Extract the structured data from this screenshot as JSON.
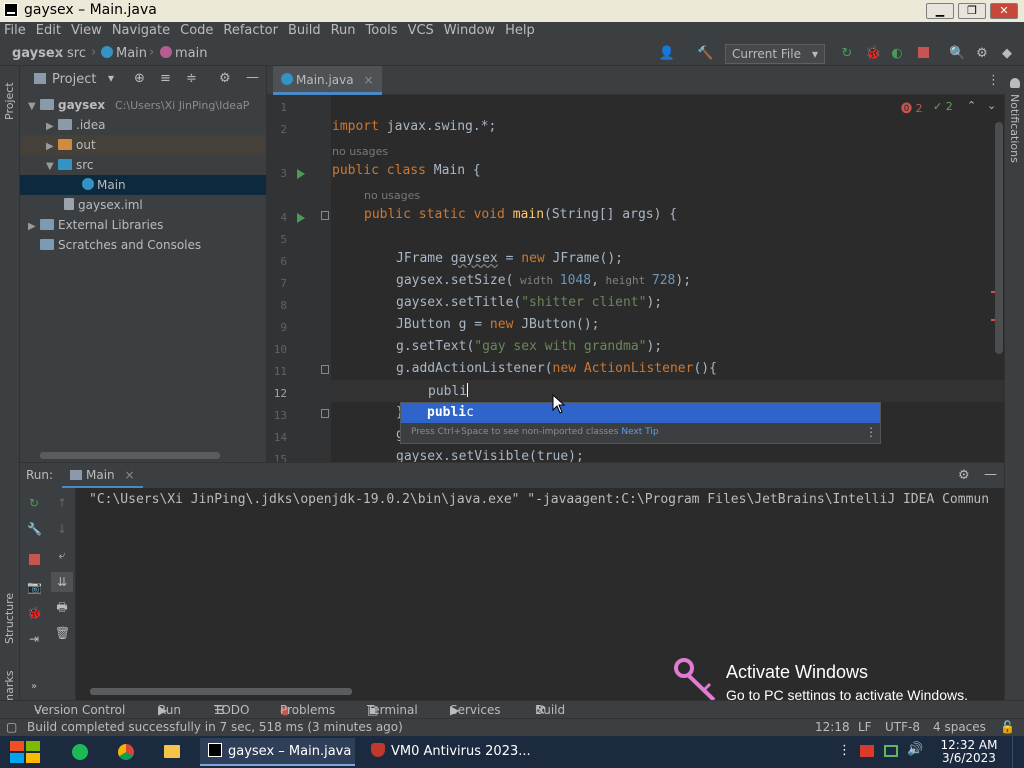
{
  "window": {
    "title": "gaysex – Main.java",
    "minimize": "▁",
    "restore": "❐",
    "close": "✕"
  },
  "menu": [
    "File",
    "Edit",
    "View",
    "Navigate",
    "Code",
    "Refactor",
    "Build",
    "Run",
    "Tools",
    "VCS",
    "Window",
    "Help"
  ],
  "breadcrumb": {
    "project": "gaysex",
    "src": "src",
    "class": "Main",
    "method": "main"
  },
  "toolbar": {
    "run_config": "Current File",
    "dropdown_arrow": "▾"
  },
  "project_panel": {
    "title": "Project",
    "root_name": "gaysex",
    "root_path": "C:\\Users\\Xi JinPing\\IdeaP",
    "items": {
      "idea": ".idea",
      "out": "out",
      "src": "src",
      "main": "Main",
      "iml": "gaysex.iml",
      "ext": "External Libraries",
      "scratches": "Scratches and Consoles"
    }
  },
  "editor": {
    "tab": "Main.java",
    "tab_close": "×",
    "inspections": {
      "errors": "2",
      "warnings": "2"
    },
    "usage_hint": "no usages",
    "code": {
      "l2_kw": "import",
      "l2_rest": " javax.swing.*;",
      "l3_kw": "public class",
      "l3_rest": " Main {",
      "l4_kw": "public static void",
      "l4_fn": "main",
      "l4_rest": "(String[] args) {",
      "l6_a": "JFrame ",
      "l6_var": "gaysex",
      "l6_b": " = ",
      "l6_kw": "new",
      "l6_c": " JFrame();",
      "l7_a": "gaysex.setSize(",
      "l7_p1": " width ",
      "l7_n1": "1048",
      "l7_b": ",",
      "l7_p2": " height ",
      "l7_n2": "728",
      "l7_c": ");",
      "l8_a": "gaysex.setTitle(",
      "l8_s": "\"shitter client\"",
      "l8_b": ");",
      "l9_a": "JButton g = ",
      "l9_kw": "new",
      "l9_b": " JButton();",
      "l10_a": "g.setText(",
      "l10_s": "\"gay sex with grandma\"",
      "l10_b": ");",
      "l11_a": "g.addActionListener(",
      "l11_kw": "new",
      "l11_cls": " ActionListener",
      "l11_b": "(){",
      "l12": "publi",
      "l13": "}",
      "l14": "g",
      "l15": "gaysex.setVisible(true);"
    },
    "completion": {
      "item_typed": "publi",
      "item_rest": "c",
      "tip": "Press Ctrl+Space to see non-imported classes",
      "next_tip": "Next Tip",
      "menu": "⋮"
    }
  },
  "run_panel": {
    "label": "Run:",
    "tab": "Main",
    "tab_close": "×",
    "output": "\"C:\\Users\\Xi JinPing\\.jdks\\openjdk-19.0.2\\bin\\java.exe\" \"-javaagent:C:\\Program Files\\JetBrains\\IntelliJ IDEA Commun"
  },
  "left_strip": {
    "project": "Project",
    "structure": "Structure",
    "bookmarks": "Bookmarks"
  },
  "right_strip": {
    "notifications": "Notifications"
  },
  "tool_tabs": [
    "Version Control",
    "Run",
    "TODO",
    "Problems",
    "Terminal",
    "Services",
    "Build"
  ],
  "status": {
    "message": "Build completed successfully in 7 sec, 518 ms (3 minutes ago)",
    "position": "12:18",
    "line_sep": "LF",
    "encoding": "UTF-8",
    "indent": "4 spaces"
  },
  "activation": {
    "title": "Activate Windows",
    "subtitle": "Go to PC settings to activate Windows."
  },
  "taskbar": {
    "task1": "gaysex – Main.java",
    "task2": "VM0 Antivirus 2023...",
    "time": "12:32 AM",
    "date": "3/6/2023"
  },
  "colors": {
    "accent_blue": "#2f65ca",
    "keyword": "#cc7832",
    "string": "#6a8759",
    "function": "#ffc66d",
    "number": "#6897bb",
    "run_green": "#499c54",
    "stop_red": "#c75450"
  }
}
